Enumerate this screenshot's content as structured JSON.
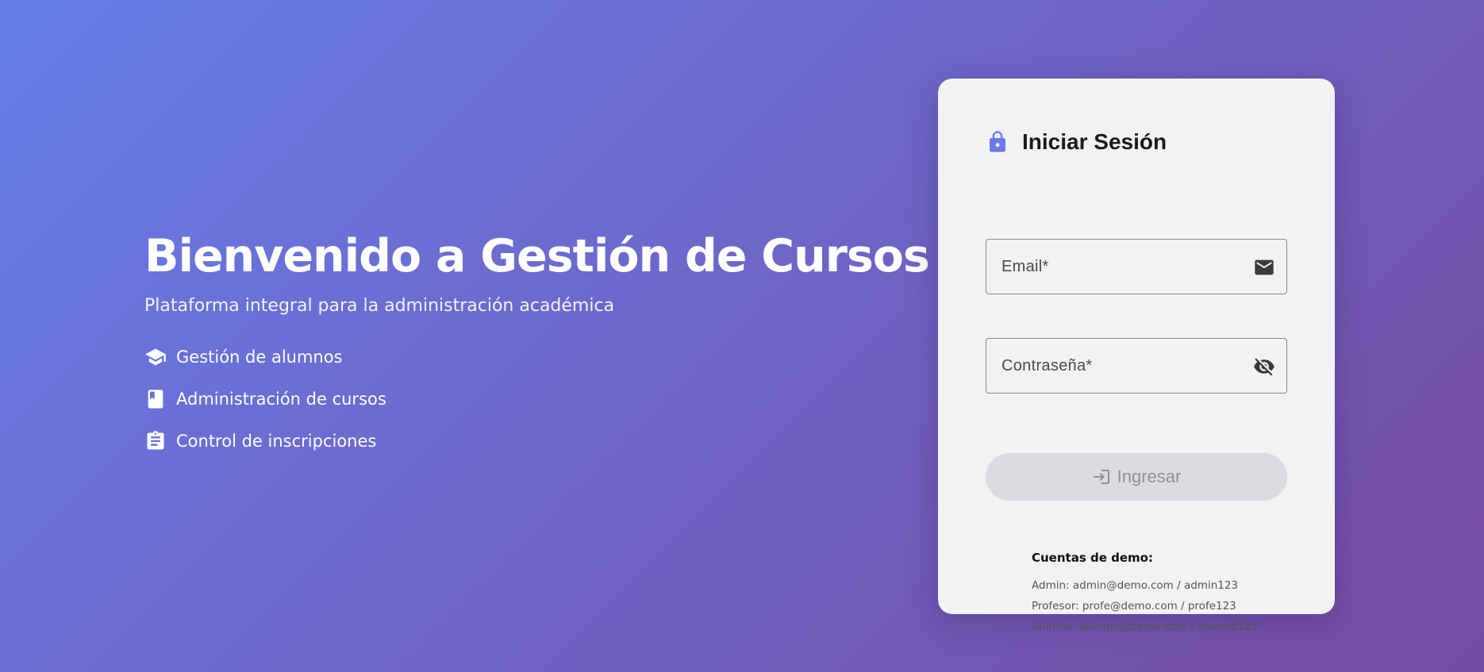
{
  "welcome": {
    "title": "Bienvenido a Gestión de Cursos",
    "subtitle": "Plataforma integral para la administración académica",
    "features": [
      {
        "icon": "graduation-cap-icon",
        "label": "Gestión de alumnos"
      },
      {
        "icon": "book-icon",
        "label": "Administración de cursos"
      },
      {
        "icon": "clipboard-icon",
        "label": "Control de inscripciones"
      }
    ]
  },
  "login": {
    "icon": "lock-icon",
    "title": "Iniciar Sesión",
    "email_label": "Email*",
    "email_value": "",
    "email_icon": "mail-icon",
    "password_label": "Contraseña*",
    "password_value": "",
    "password_icon": "visibility-off-icon",
    "submit_icon": "login-icon",
    "submit_label": "Ingresar",
    "demo": {
      "title": "Cuentas de demo:",
      "accounts": [
        "Admin: admin@demo.com / admin123",
        "Profesor: profe@demo.com / profe123",
        "Alumno: alumno@demo.com / alumno123"
      ]
    }
  },
  "colors": {
    "gradient_start": "#667eea",
    "gradient_end": "#764ba2",
    "card_background": "#f2f2f4",
    "accent": "#6b7be6",
    "button_disabled": "#dcdce0"
  }
}
